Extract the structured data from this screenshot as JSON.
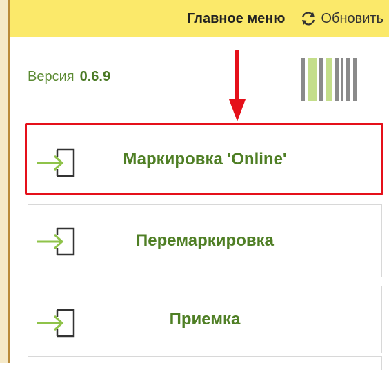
{
  "header": {
    "main_menu_label": "Главное меню",
    "refresh_label": "Обновить"
  },
  "version": {
    "label": "Версия",
    "value": "0.6.9"
  },
  "menu": {
    "items": [
      {
        "label": "Маркировка 'Online'"
      },
      {
        "label": "Перемаркировка"
      },
      {
        "label": "Приемка"
      }
    ]
  },
  "colors": {
    "topbar": "#fbe96a",
    "accent_green": "#4f7f25",
    "highlight_red": "#e5101a"
  },
  "icons": {
    "refresh": "refresh-icon",
    "login": "sign-in-icon",
    "barcode": "barcode-icon",
    "arrow": "down-arrow-annotation"
  }
}
